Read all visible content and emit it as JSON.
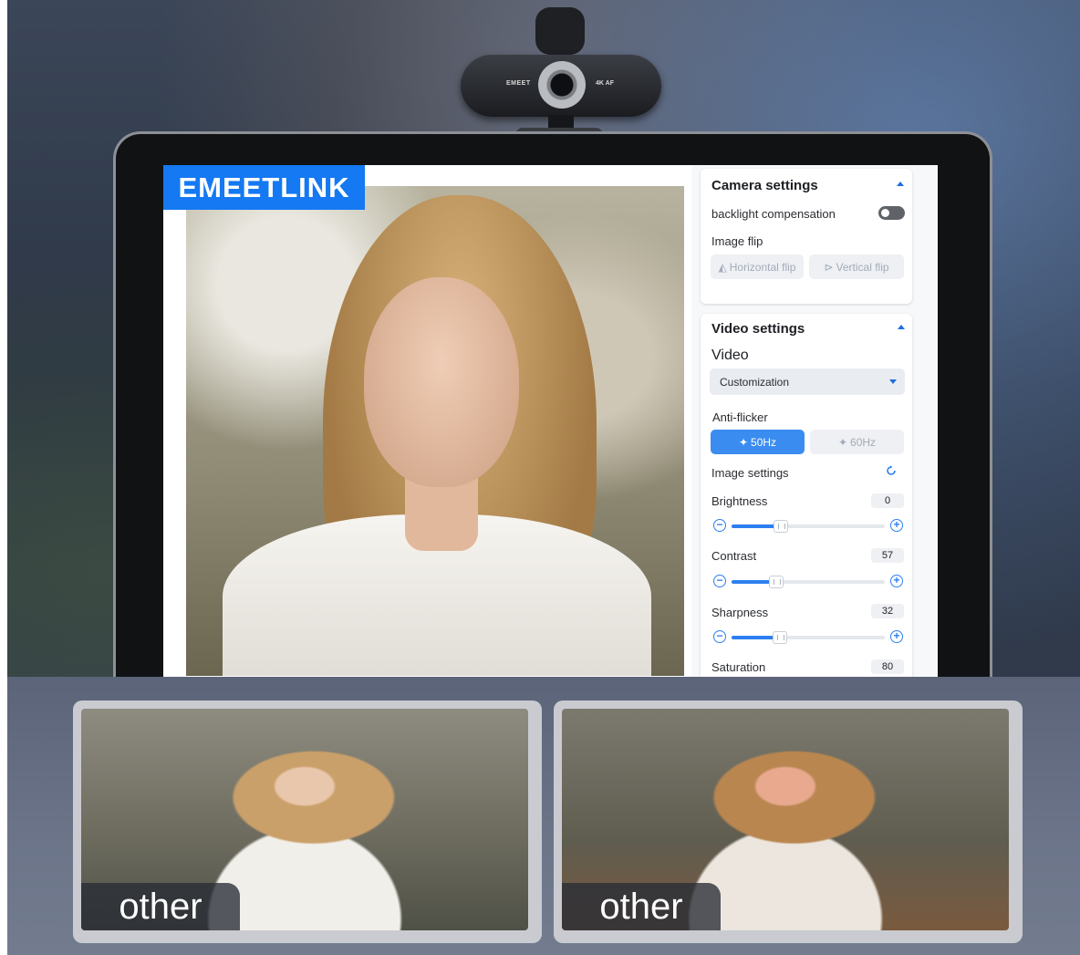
{
  "brand_badge": "EMEETLINK",
  "webcam": {
    "brand": "EMEET",
    "spec": "4K AF"
  },
  "camera_settings": {
    "title": "Camera settings",
    "backlight_label": "backlight compensation",
    "backlight_on": false,
    "image_flip_label": "Image flip",
    "horizontal_flip": "Horizontal flip",
    "vertical_flip": "Vertical flip"
  },
  "video_settings": {
    "title": "Video settings",
    "video_label": "Video",
    "video_mode": "Customization",
    "anti_flicker_label": "Anti-flicker",
    "anti_flicker_options": [
      "50Hz",
      "60Hz"
    ],
    "anti_flicker_selected": "50Hz",
    "image_settings_label": "Image settings",
    "sliders": [
      {
        "label": "Brightness",
        "value": "0",
        "level": 0.3
      },
      {
        "label": "Contrast",
        "value": "57",
        "level": 0.27
      },
      {
        "label": "Sharpness",
        "value": "32",
        "level": 0.29
      }
    ],
    "saturation_label": "Saturation",
    "saturation_value": "80"
  },
  "comparison": [
    {
      "label": "other"
    },
    {
      "label": "other"
    }
  ],
  "colors": {
    "accent": "#1479f2",
    "primary_button": "#3b8cf0",
    "slider_fill": "#2d7ff0"
  }
}
